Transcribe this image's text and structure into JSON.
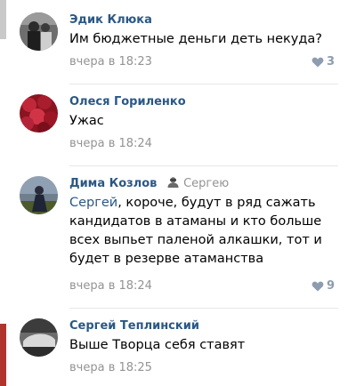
{
  "comments": [
    {
      "author": "Эдик Клюка",
      "text": "Им бюджетные деньги деть некуда?",
      "time": "вчера в 18:23",
      "likes": "3"
    },
    {
      "author": "Олеся Гориленко",
      "text": "Ужас",
      "time": "вчера в 18:24"
    },
    {
      "author": "Дима Козлов",
      "reply_to": "Сергею",
      "mention": "Сергей",
      "text": ", короче, будут в ряд сажать кандидатов в атаманы и кто больше всех выпьет паленой алкашки, тот и будет в резерве атаманства",
      "time": "вчера в 18:24",
      "likes": "9"
    },
    {
      "author": "Сергей Теплинский",
      "text": "Выше Творца себя ставят",
      "time": "вчера в 18:25"
    }
  ],
  "colors": {
    "author_link": "#2a5885",
    "meta_gray": "#939393",
    "like_icon": "#8d9caf"
  },
  "icons": {
    "like": "heart-icon",
    "reply_user": "user-icon"
  }
}
